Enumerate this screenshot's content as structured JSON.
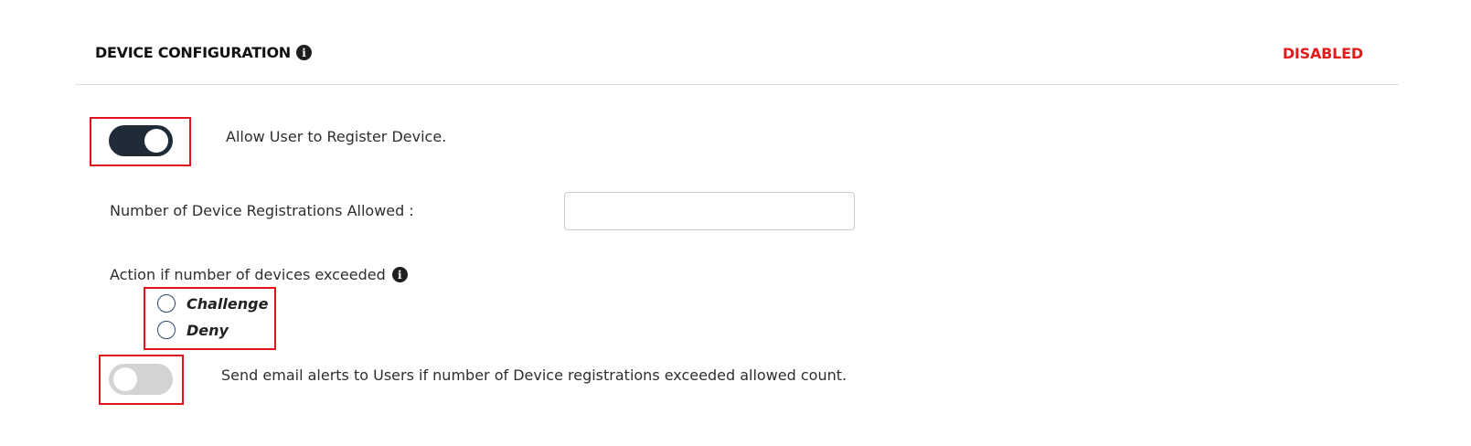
{
  "header": {
    "title": "DEVICE CONFIGURATION",
    "info_icon": "info-icon",
    "status": "DISABLED",
    "status_color": "#e31b1b"
  },
  "register_device": {
    "toggle_state": "on",
    "label": "Allow User to Register Device."
  },
  "registrations_allowed": {
    "label": "Number of Device Registrations Allowed :",
    "value": ""
  },
  "exceeded_action": {
    "label": "Action if number of devices exceeded",
    "info_icon": "info-icon",
    "options": [
      {
        "label": "Challenge",
        "selected": false
      },
      {
        "label": "Deny",
        "selected": false
      }
    ]
  },
  "email_alerts": {
    "toggle_state": "off",
    "label": "Send email alerts to Users if number of Device registrations exceeded allowed count."
  },
  "colors": {
    "highlight": "#e0121a",
    "toggle_on": "#1f2c37",
    "toggle_off": "#d3d3d3"
  }
}
